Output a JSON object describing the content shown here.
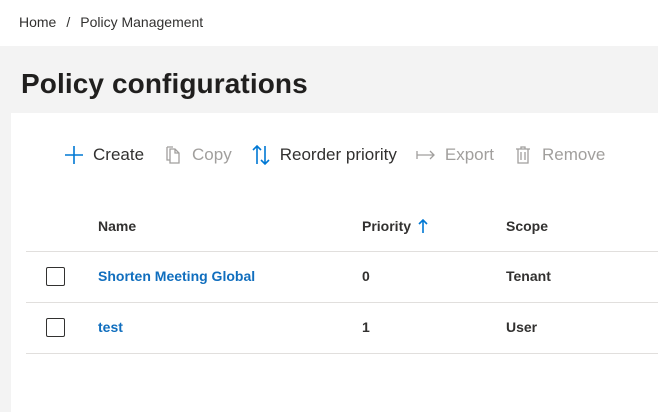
{
  "breadcrumb": {
    "home": "Home",
    "separator": "/",
    "current": "Policy Management"
  },
  "page": {
    "title": "Policy configurations"
  },
  "toolbar": {
    "create": "Create",
    "copy": "Copy",
    "reorder": "Reorder priority",
    "export": "Export",
    "remove": "Remove"
  },
  "table": {
    "columns": {
      "name": "Name",
      "priority": "Priority",
      "scope": "Scope"
    },
    "sort": {
      "column": "priority",
      "direction": "ascending"
    },
    "rows": [
      {
        "name": "Shorten Meeting Global",
        "priority": "0",
        "scope": "Tenant"
      },
      {
        "name": "test",
        "priority": "1",
        "scope": "User"
      }
    ]
  },
  "colors": {
    "accent": "#0078d4",
    "link": "#106ebe",
    "disabled": "#a19f9d",
    "text": "#323130"
  }
}
